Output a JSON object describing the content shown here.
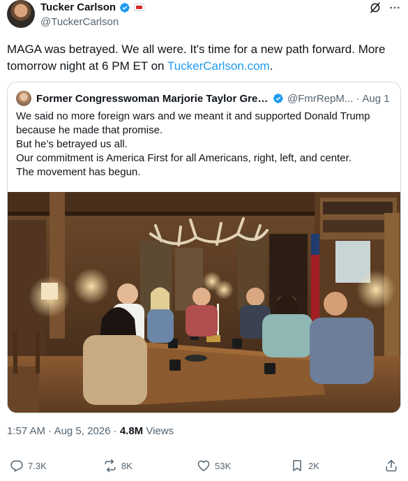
{
  "author": {
    "display_name": "Tucker Carlson",
    "handle": "@TuckerCarlson"
  },
  "tweet": {
    "text_before_link": "MAGA was betrayed. We all were. It's time for a new path forward. More tomorrow night at 6 PM ET on ",
    "link_text": "TuckerCarlson.com",
    "text_after_link": "."
  },
  "quoted_tweet": {
    "display_name": "Former Congresswoman Marjorie Taylor Gree...",
    "handle": "@FmrRepM...",
    "separator": "·",
    "date": "Aug 1",
    "lines": [
      "We said no more foreign wars and we meant it and supported Donald Trump",
      "because he made that promise.",
      "But he’s betrayed us all.",
      "Our commitment is America First for all Americans, right, left, and center.",
      "The movement has begun."
    ]
  },
  "meta": {
    "time": "1:57 AM",
    "separator": "·",
    "date": "Aug 5, 2026",
    "views_count": "4.8M",
    "views_label": "Views"
  },
  "actions": {
    "replies": "7.3K",
    "reposts": "8K",
    "likes": "53K",
    "bookmarks": "2K"
  },
  "icons": {
    "verified": "verified-badge-icon",
    "affiliation": "affiliation-badge-icon",
    "grok": "grok-icon",
    "reply": "reply-icon",
    "repost": "repost-icon",
    "like": "heart-icon",
    "bookmark": "bookmark-icon",
    "share": "share-icon"
  },
  "colors": {
    "accent": "#1d9bf0",
    "text": "#0f1419",
    "muted": "#536471",
    "border": "#cfd9de"
  }
}
